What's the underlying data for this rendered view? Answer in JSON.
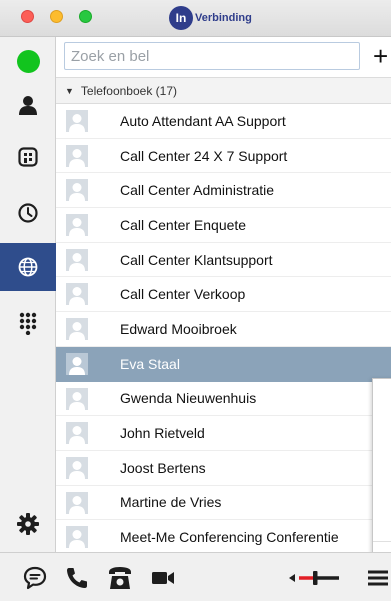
{
  "app": {
    "logo_badge": "In",
    "logo_text": "Verbinding",
    "accent": "#2f4d8c"
  },
  "search": {
    "placeholder": "Zoek en bel",
    "value": "",
    "add_label": "+"
  },
  "group": {
    "arrow": "▼",
    "label": "Telefoonboek (17)"
  },
  "sidebar": {
    "items": [
      {
        "icon": "presence-status-icon",
        "status_color": "#12c41e"
      },
      {
        "icon": "person-icon"
      },
      {
        "icon": "building-icon"
      },
      {
        "icon": "clock-icon"
      },
      {
        "icon": "globe-icon",
        "active": true
      },
      {
        "icon": "dialpad-icon"
      },
      {
        "icon": "gear-icon"
      }
    ]
  },
  "contacts": [
    "Auto Attendant AA Support",
    "Call Center 24 X 7 Support",
    "Call Center Administratie",
    "Call Center Enquete",
    "Call Center Klantsupport",
    "Call Center Verkoop",
    "Edward Mooibroek",
    "Eva Staal",
    "Gwenda Nieuwenhuis",
    "John Rietveld",
    "Joost Bertens",
    "Martine de Vries",
    "Meet-Me Conferencing Conferentie"
  ],
  "selected_contact": "Eva Staal",
  "selection_color": "#8ba3b9",
  "bottombar": {
    "icons": [
      "chat-icon",
      "phone-icon",
      "desk-phone-icon",
      "video-camera-icon",
      "volume-icon",
      "menu-icon"
    ]
  }
}
